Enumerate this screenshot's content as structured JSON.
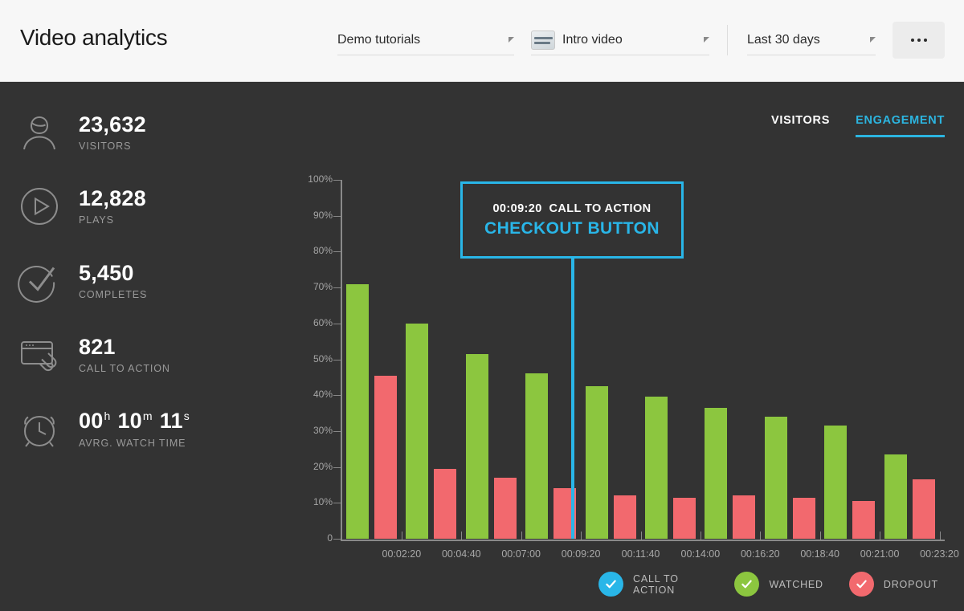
{
  "header": {
    "title": "Video analytics",
    "playlist_select": {
      "value": "Demo tutorials",
      "icon": "chevron-down-icon"
    },
    "video_select": {
      "value": "Intro video",
      "icon": "chevron-down-icon",
      "thumb": "video-thumbnail-icon"
    },
    "range_select": {
      "value": "Last 30 days",
      "icon": "chevron-down-icon"
    },
    "more_button": {
      "label": "•••",
      "icon": "more-horizontal-icon"
    }
  },
  "stats": [
    {
      "value": "23,632",
      "label": "VISITORS",
      "icon": "person-icon"
    },
    {
      "value": "12,828",
      "label": "PLAYS",
      "icon": "play-circle-icon"
    },
    {
      "value": "5,450",
      "label": "COMPLETES",
      "icon": "check-circle-icon"
    },
    {
      "value": "821",
      "label": "CALL TO ACTION",
      "icon": "window-link-icon"
    }
  ],
  "watch_time": {
    "hours": "00",
    "hours_unit": "h",
    "minutes": "10",
    "minutes_unit": "m",
    "seconds": "11",
    "seconds_unit": "s",
    "label": "AVRG. WATCH TIME",
    "icon": "alarm-clock-icon"
  },
  "tabs": [
    {
      "label": "VISITORS",
      "active": false
    },
    {
      "label": "ENGAGEMENT",
      "active": true
    }
  ],
  "callout": {
    "timestamp": "00:09:20",
    "type": "CALL TO ACTION",
    "name": "CHECKOUT BUTTON",
    "at_x_value": "00:09:20"
  },
  "colors": {
    "accent": "#29b6e8",
    "watched": "#8cc63f",
    "dropout": "#f2696e",
    "background": "#333333",
    "header_background": "#f7f7f7"
  },
  "chart_data": {
    "type": "bar",
    "title": "",
    "xlabel": "",
    "ylabel": "",
    "ylim": [
      0,
      100
    ],
    "grid": false,
    "legend_position": "bottom-right",
    "ytick_labels": [
      "100%",
      "90%",
      "80%",
      "70%",
      "60%",
      "50%",
      "40%",
      "30%",
      "20%",
      "10%",
      "0"
    ],
    "ytick_values": [
      100,
      90,
      80,
      70,
      60,
      50,
      40,
      30,
      20,
      10,
      0
    ],
    "xtick_labels": [
      "00:02:20",
      "00:04:40",
      "00:07:00",
      "00:09:20",
      "00:11:40",
      "00:14:00",
      "00:16:20",
      "00:18:40",
      "00:21:00",
      "00:23:20"
    ],
    "series": [
      {
        "name": "WATCHED",
        "color": "#8cc63f",
        "values": [
          71,
          60,
          51.5,
          46,
          42.5,
          39.5,
          36.5,
          34,
          31.5,
          23.5
        ]
      },
      {
        "name": "DROPOUT",
        "color": "#f2696e",
        "values": [
          45.5,
          19.5,
          17,
          14,
          12,
          11.5,
          12,
          11.5,
          10.5,
          16.5
        ]
      }
    ],
    "legend": [
      {
        "label": "CALL TO ACTION",
        "color": "#29b6e8",
        "icon": "check-icon"
      },
      {
        "label": "WATCHED",
        "color": "#8cc63f",
        "icon": "check-icon"
      },
      {
        "label": "DROPOUT",
        "color": "#f2696e",
        "icon": "check-icon"
      }
    ],
    "annotations": [
      {
        "x": "00:09:20",
        "label": "CALL TO ACTION",
        "value": "CHECKOUT BUTTON"
      }
    ]
  }
}
